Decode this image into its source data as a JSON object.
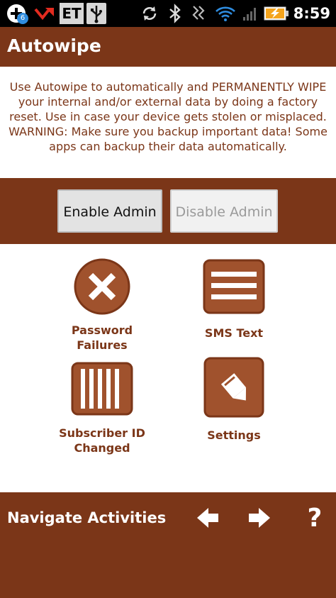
{
  "status_bar": {
    "notification_badge": "6",
    "carrier_icon_text": "ET",
    "time": "8:59",
    "icons": [
      "plus-icon",
      "missed-call-icon",
      "et-icon",
      "usb-icon",
      "sync-icon",
      "bluetooth-icon",
      "vibrate-icon",
      "wifi-icon",
      "signal-icon",
      "battery-charging-icon"
    ]
  },
  "header": {
    "title": "Autowipe"
  },
  "description": "Use Autowipe to automatically and PERMANENTLY WIPE your internal and/or external data by doing a factory reset. Use in case your device gets stolen or misplaced. WARNING: Make sure you backup important data! Some apps can backup their data automatically.",
  "admin": {
    "enable_label": "Enable Admin",
    "disable_label": "Disable Admin"
  },
  "grid": {
    "password_failures": "Password\nFailures",
    "sms_text": "SMS Text",
    "subscriber_id_changed": "Subscriber ID\nChanged",
    "settings": "Settings"
  },
  "footer": {
    "title": "Navigate Activities",
    "help_label": "?",
    "icons": [
      "arrow-left-icon",
      "arrow-right-icon"
    ]
  },
  "colors": {
    "brand_brown": "#7b3618",
    "icon_brown": "#a0522d",
    "text_brown": "#7b3618"
  }
}
